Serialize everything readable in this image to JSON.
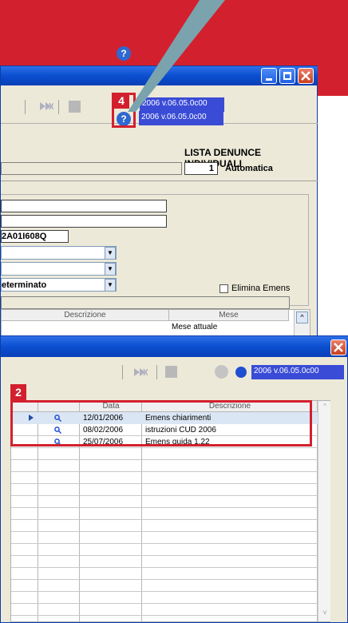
{
  "callouts": {
    "marker_4": "4",
    "marker_2": "2"
  },
  "win1": {
    "version": "2006 v.06.05.0c00",
    "help_glyph": "?",
    "title": "LISTA DENUNCE INDIVIDUALI",
    "count_value": "1",
    "mode_label": "Automatica",
    "code_value": "2A01I608Q",
    "contract_value": "eterminato",
    "checkbox_label": "Elimina Emens",
    "table_headers": {
      "descrizione": "Descrizione",
      "mese": "Mese"
    },
    "first_row_mese": "Mese attuale"
  },
  "win2": {
    "version": "2006 v.06.05.0c00",
    "headers": {
      "data": "Data",
      "descrizione": "Descrizione"
    },
    "rows": [
      {
        "data": "12/01/2006",
        "descrizione": "Emens  chiarimenti"
      },
      {
        "data": "08/02/2006",
        "descrizione": "istruzioni  CUD  2006"
      },
      {
        "data": "25/07/2006",
        "descrizione": "Emens  guida  1.22"
      }
    ]
  },
  "colors": {
    "red": "#d3202e",
    "xp_blue": "#0a4fd0",
    "version_bg": "#3a4cd6"
  },
  "icons": [
    "help-icon",
    "magnifier-icon",
    "row-arrow-icon",
    "close-icon",
    "minimize-icon",
    "maximize-icon",
    "skip-icon",
    "stop-icon"
  ]
}
